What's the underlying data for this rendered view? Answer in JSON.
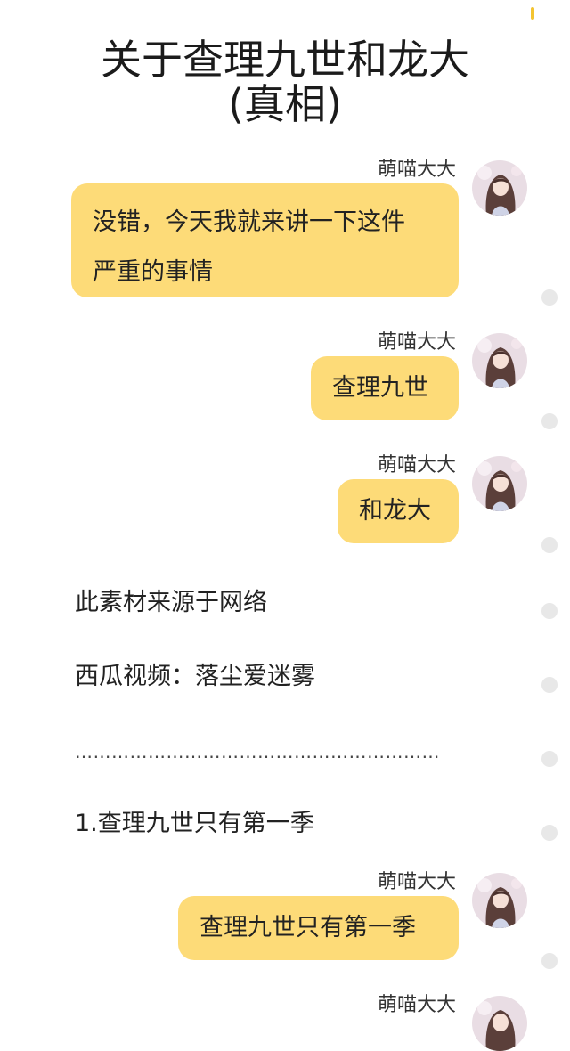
{
  "article": {
    "title_line1": "关于查理九世和龙大",
    "title_line2": "(真相)"
  },
  "author_name": "萌喵大大",
  "messages": [
    {
      "author": "萌喵大大",
      "text": "没错，今天我就来讲一下这件\n严重的事情"
    },
    {
      "author": "萌喵大大",
      "text": "查理九世"
    },
    {
      "author": "萌喵大大",
      "text": "和龙大"
    },
    {
      "author": "萌喵大大",
      "text": "查理九世只有第一季"
    },
    {
      "author": "萌喵大大",
      "text": ""
    }
  ],
  "body_lines": [
    "此素材来源于网络",
    "西瓜视频：落尘爱迷雾",
    "……………………………………………………",
    "1.查理九世只有第一季"
  ],
  "colors": {
    "bubble": "#fddb78",
    "scroll_indicator": "#f4c430",
    "side_dot": "#e8e8e8"
  },
  "icons": {
    "avatar": "anime-girl-avatar"
  }
}
